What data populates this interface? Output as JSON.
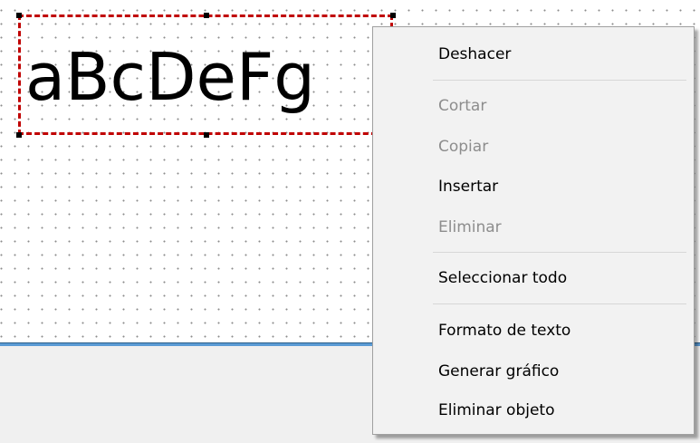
{
  "canvas": {
    "text_object": {
      "text": "aBcDeFg"
    }
  },
  "context_menu": {
    "items": [
      {
        "label": "Deshacer",
        "enabled": true
      },
      {
        "label": "Cortar",
        "enabled": false
      },
      {
        "label": "Copiar",
        "enabled": false
      },
      {
        "label": "Insertar",
        "enabled": true
      },
      {
        "label": "Eliminar",
        "enabled": false
      },
      {
        "label": "Seleccionar todo",
        "enabled": true
      },
      {
        "label": "Formato de texto",
        "enabled": true
      },
      {
        "label": "Generar gráfico",
        "enabled": true
      },
      {
        "label": "Eliminar objeto",
        "enabled": true
      }
    ]
  },
  "colors": {
    "selection_border": "#c00000",
    "canvas_bottom_border": "#5b9bd5",
    "menu_background": "#f2f2f2",
    "disabled_text": "#8d8d8d"
  }
}
